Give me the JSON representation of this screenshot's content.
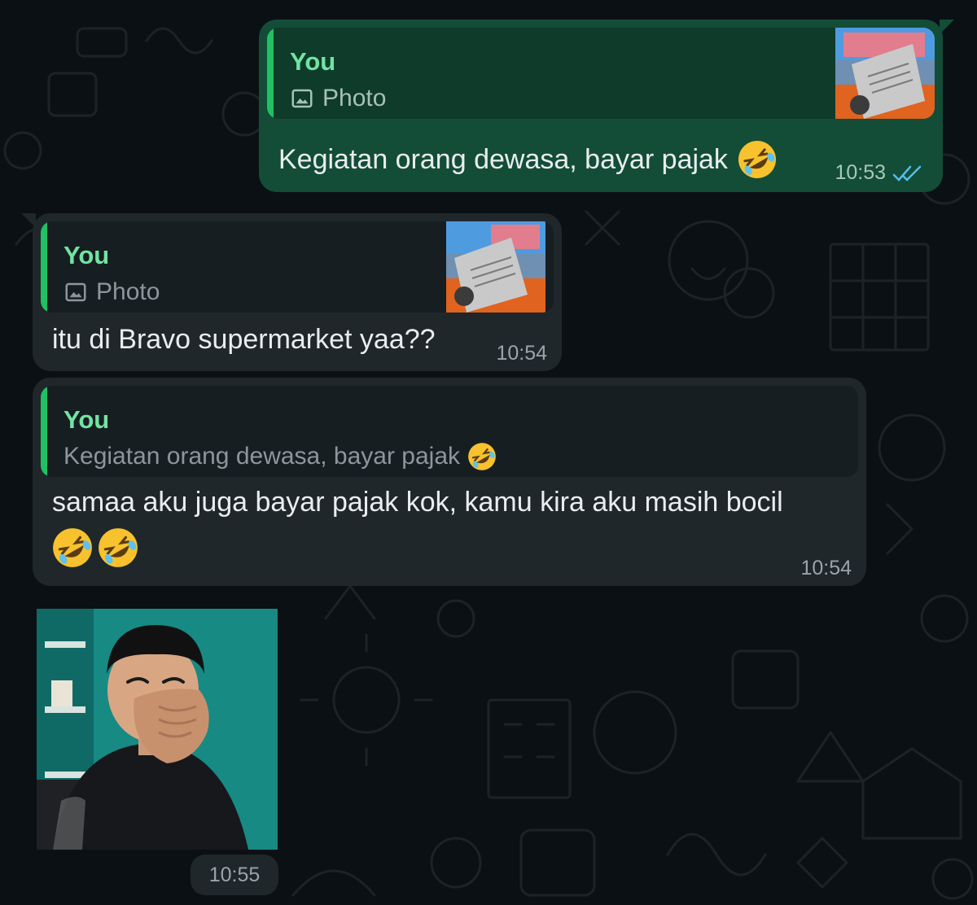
{
  "colors": {
    "background": "#0b1014",
    "outgoing_bubble": "#134d37",
    "incoming_bubble": "#1f272a",
    "quote_accent": "#21c063",
    "quote_author": "#72e3a2",
    "read_ticks": "#53bdeb"
  },
  "messages": [
    {
      "direction": "outgoing",
      "quote": {
        "author": "You",
        "icon": "image-icon",
        "text": "Photo"
      },
      "text": "Kegiatan orang dewasa, bayar pajak",
      "emoji": "rolling-on-floor-laughing",
      "time": "10:53",
      "status": "read"
    },
    {
      "direction": "incoming",
      "quote": {
        "author": "You",
        "icon": "image-icon",
        "text": "Photo"
      },
      "text": "itu di Bravo supermarket yaa??",
      "time": "10:54"
    },
    {
      "direction": "incoming",
      "quote": {
        "author": "You",
        "text": "Kegiatan orang dewasa, bayar pajak",
        "emoji": "rolling-on-floor-laughing"
      },
      "text": "samaa aku juga bayar pajak kok, kamu kira aku masih bocil",
      "emoji_count": 2,
      "time": "10:54"
    },
    {
      "direction": "incoming",
      "type": "photo",
      "description_icon": "sticker-photo",
      "time": "10:55"
    }
  ]
}
